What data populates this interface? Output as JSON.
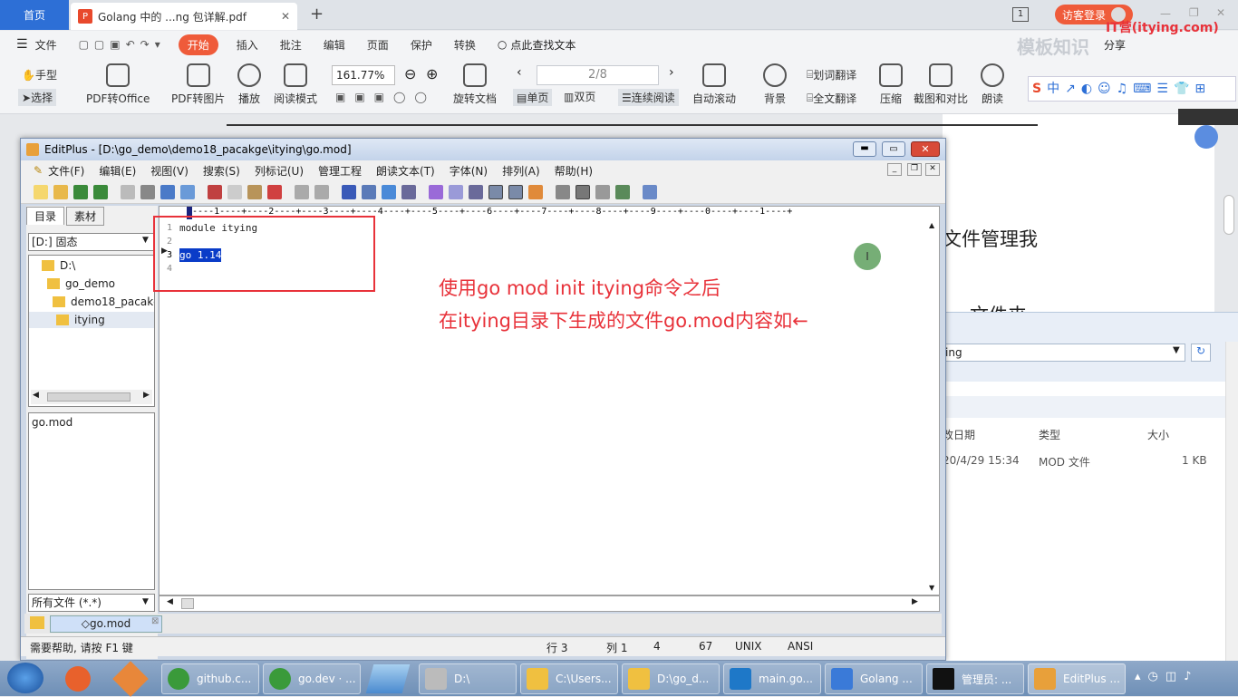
{
  "wps": {
    "home_tab": "首页",
    "doc_tab": "Golang 中的 ...ng 包详解.pdf",
    "login": "访客登录",
    "login_count": "1",
    "share": "分享",
    "menus": [
      "文件",
      "开始",
      "插入",
      "批注",
      "编辑",
      "页面",
      "保护",
      "转换"
    ],
    "active_menu": "开始",
    "search_hint": "点此查找文本",
    "ribbon": {
      "hand": "手型",
      "select": "选择",
      "pdf_to_office": "PDF转Office",
      "pdf_to_image": "PDF转图片",
      "play": "播放",
      "read_mode": "阅读模式",
      "zoom": "161.77%",
      "rotate": "旋转文档",
      "page": "2/8",
      "single": "单页",
      "double": "双页",
      "continuous": "连续阅读",
      "autoscroll": "自动滚动",
      "background": "背景",
      "word_translate": "划词翻译",
      "full_translate": "全文翻译",
      "compress": "压缩",
      "screenshot": "截图和对比",
      "read_aloud": "朗读"
    },
    "brand_logo": "IT营(itying.com)",
    "watermark": "模板知识"
  },
  "pdf_bg": {
    "text1": "文件管理我",
    "text2": "文件夹"
  },
  "explorer": {
    "path_tail": "ing",
    "columns": [
      "改日期",
      "类型",
      "大小"
    ],
    "row": {
      "date": "20/4/29 15:34",
      "type": "MOD 文件",
      "size": "1 KB"
    }
  },
  "editplus": {
    "title": "EditPlus - [D:\\go_demo\\demo18_pacakge\\itying\\go.mod]",
    "menus": [
      "文件(F)",
      "编辑(E)",
      "视图(V)",
      "搜索(S)",
      "列标记(U)",
      "管理工程",
      "朗读文本(T)",
      "字体(N)",
      "排列(A)",
      "帮助(H)"
    ],
    "tabs": [
      "目录",
      "素材"
    ],
    "drive": "[D:] 固态",
    "tree": [
      "D:\\",
      "go_demo",
      "demo18_pacakge",
      "itying"
    ],
    "files": [
      "go.mod"
    ],
    "filter": "所有文件 (*.*)",
    "open_tab": "go.mod",
    "ruler": "+----1----+----2----+----3----+----4----+----5----+----6----+----7----+----8----+----9----+----0----+----1----+",
    "lines": [
      {
        "n": "1",
        "text": "module itying"
      },
      {
        "n": "2",
        "text": ""
      },
      {
        "n": "3",
        "text": "go 1.14"
      },
      {
        "n": "4",
        "text": ""
      }
    ],
    "status": {
      "help": "需要帮助, 请按 F1 键",
      "row": "行 3",
      "col": "列 1",
      "a": "4",
      "b": "67",
      "eol": "UNIX",
      "enc": "ANSI"
    }
  },
  "annotation": {
    "line1": "使用go mod init itying命令之后",
    "line2": "在itying目录下生成的文件go.mod内容如←"
  },
  "taskbar": {
    "items": [
      "github.c...",
      "go.dev · ...",
      "D:\\",
      "C:\\Users...",
      "D:\\go_d...",
      "main.go...",
      "Golang ...",
      "管理员: ...",
      "EditPlus ..."
    ]
  },
  "colors": {
    "wps_accent": "#ef5b3a",
    "wps_blue": "#2d6fd6",
    "annotation": "#e8323a"
  }
}
